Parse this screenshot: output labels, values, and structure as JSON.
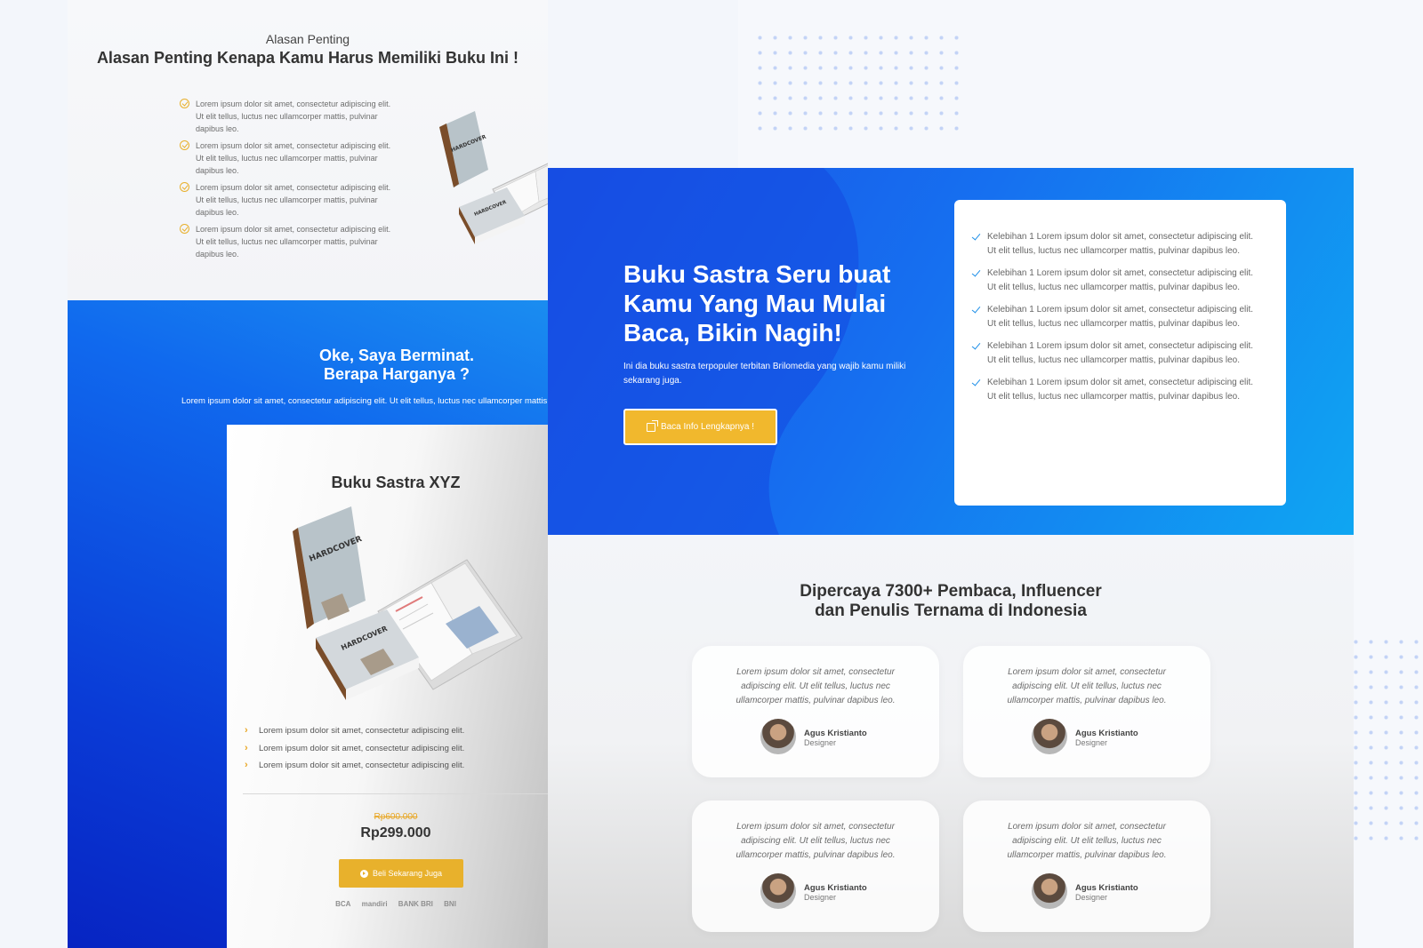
{
  "reasons_section": {
    "eyebrow": "Alasan Penting",
    "title": "Alasan Penting Kenapa Kamu Harus Memiliki Buku Ini !",
    "items": [
      "Lorem ipsum dolor sit amet, consectetur adipiscing elit. Ut elit tellus, luctus nec ullamcorper mattis, pulvinar dapibus leo.",
      "Lorem ipsum dolor sit amet, consectetur adipiscing elit. Ut elit tellus, luctus nec ullamcorper mattis, pulvinar dapibus leo.",
      "Lorem ipsum dolor sit amet, consectetur adipiscing elit. Ut elit tellus, luctus nec ullamcorper mattis, pulvinar dapibus leo.",
      "Lorem ipsum dolor sit amet, consectetur adipiscing elit. Ut elit tellus, luctus nec ullamcorper mattis, pulvinar dapibus leo."
    ],
    "check_color": "#e8b02c"
  },
  "pricing_section": {
    "title_line1": "Oke, Saya Berminat.",
    "title_line2": "Berapa Harganya ?",
    "subtitle": "Lorem ipsum dolor sit amet, consectetur adipiscing elit. Ut elit tellus, luctus nec ullamcorper mattis,",
    "card": {
      "title": "Buku Sastra XYZ",
      "features": [
        "Lorem ipsum dolor sit amet, consectetur adipiscing elit.",
        "Lorem ipsum dolor sit amet, consectetur adipiscing elit.",
        "Lorem ipsum dolor sit amet, consectetur adipiscing elit."
      ],
      "old_price": "Rp600.000",
      "price": "Rp299.000",
      "buy_label": "Beli Sekarang Juga",
      "banks": [
        "BCA",
        "mandiri",
        "BANK BRI",
        "BNI"
      ]
    }
  },
  "book_mockup": {
    "cover_text": "HARDCOVER"
  },
  "hero_section": {
    "title": "Buku Sastra Seru buat Kamu Yang Mau Mulai Baca, Bikin Nagih!",
    "text": "Ini dia buku sastra terpopuler terbitan Brilomedia yang wajib kamu miliki sekarang juga.",
    "button_label": "Baca Info Lengkapnya !",
    "benefits": [
      "Kelebihan 1 Lorem ipsum dolor sit amet, consectetur adipiscing elit. Ut elit tellus, luctus nec ullamcorper mattis, pulvinar dapibus leo.",
      "Kelebihan 1 Lorem ipsum dolor sit amet, consectetur adipiscing elit. Ut elit tellus, luctus nec ullamcorper mattis, pulvinar dapibus leo.",
      "Kelebihan 1 Lorem ipsum dolor sit amet, consectetur adipiscing elit. Ut elit tellus, luctus nec ullamcorper mattis, pulvinar dapibus leo.",
      "Kelebihan 1 Lorem ipsum dolor sit amet, consectetur adipiscing elit. Ut elit tellus, luctus nec ullamcorper mattis, pulvinar dapibus leo.",
      "Kelebihan 1 Lorem ipsum dolor sit amet, consectetur adipiscing elit. Ut elit tellus, luctus nec ullamcorper mattis, pulvinar dapibus leo."
    ],
    "accent_color": "#f1b82d"
  },
  "testimonials_section": {
    "title_line1": "Dipercaya 7300+ Pembaca, Influencer",
    "title_line2": "dan Penulis Ternama di Indonesia",
    "items": [
      {
        "quote": "Lorem ipsum dolor sit amet, consectetur adipiscing elit. Ut elit tellus, luctus nec ullamcorper mattis, pulvinar dapibus leo.",
        "name": "Agus Kristianto",
        "role": "Designer"
      },
      {
        "quote": "Lorem ipsum dolor sit amet, consectetur adipiscing elit. Ut elit tellus, luctus nec ullamcorper mattis, pulvinar dapibus leo.",
        "name": "Agus Kristianto",
        "role": "Designer"
      },
      {
        "quote": "Lorem ipsum dolor sit amet, consectetur adipiscing elit. Ut elit tellus, luctus nec ullamcorper mattis, pulvinar dapibus leo.",
        "name": "Agus Kristianto",
        "role": "Designer"
      },
      {
        "quote": "Lorem ipsum dolor sit amet, consectetur adipiscing elit. Ut elit tellus, luctus nec ullamcorper mattis, pulvinar dapibus leo.",
        "name": "Agus Kristianto",
        "role": "Designer"
      }
    ]
  }
}
